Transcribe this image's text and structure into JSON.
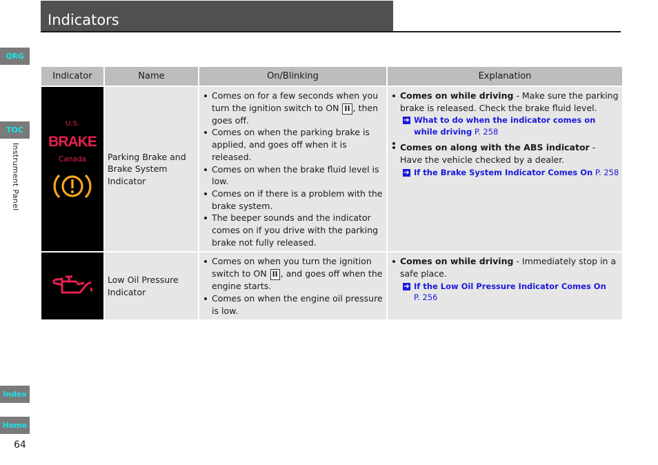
{
  "page": {
    "title": "Indicators",
    "section_label": "Instrument Panel",
    "page_number": "64"
  },
  "side_tabs": {
    "qrg": "QRG",
    "toc": "TOC",
    "index": "Index",
    "home": "Home"
  },
  "colors": {
    "title_bar": "#505050",
    "tab_text": "#19e3e9",
    "link": "#1a1adb",
    "warning_red": "#e8204f",
    "warning_amber": "#f5a623"
  },
  "table": {
    "headers": [
      "Indicator",
      "Name",
      "On/Blinking",
      "Explanation"
    ],
    "rows": [
      {
        "indicator": {
          "icon": "brake-warning-icon",
          "us_label": "U.S.",
          "brake_text": "BRAKE",
          "canada_label": "Canada",
          "canada_icon": "circle-exclamation-icon"
        },
        "name": "Parking Brake and Brake System Indicator",
        "on_blinking": [
          {
            "before": "Comes on for a few seconds when you turn the ignition switch to ON ",
            "switch": "II",
            "after": ", then goes off."
          },
          {
            "before": "Comes on when the parking brake is applied, and goes off when it is released.",
            "switch": null,
            "after": ""
          },
          {
            "before": "Comes on when the brake fluid level is low.",
            "switch": null,
            "after": ""
          },
          {
            "before": "Comes on if there is a problem with the brake system.",
            "switch": null,
            "after": ""
          },
          {
            "before": "The beeper sounds and the indicator comes on if you drive with the parking brake not fully released.",
            "switch": null,
            "after": ""
          }
        ],
        "explanation": [
          {
            "bold": "Comes on while driving",
            "text": " - Make sure the parking brake is released. Check the brake fluid level.",
            "ref_title": "What to do when the indicator comes on while driving",
            "ref_page": "P. 258"
          },
          {
            "bold": "Comes on along with the ABS indicator",
            "text": " - Have the vehicle checked by a dealer.",
            "ref_title": "If the Brake System Indicator Comes On",
            "ref_page": "P. 258"
          }
        ]
      },
      {
        "indicator": {
          "icon": "oil-can-icon"
        },
        "name": "Low Oil Pressure Indicator",
        "on_blinking": [
          {
            "before": "Comes on when you turn the ignition switch to ON ",
            "switch": "II",
            "after": ", and goes off when the engine starts."
          },
          {
            "before": "Comes on when the engine oil pressure is low.",
            "switch": null,
            "after": ""
          }
        ],
        "explanation": [
          {
            "bold": "Comes on while driving",
            "text": " - Immediately stop in a safe place.",
            "ref_title": "If the Low Oil Pressure Indicator Comes On",
            "ref_page": "P. 256"
          }
        ]
      }
    ]
  }
}
